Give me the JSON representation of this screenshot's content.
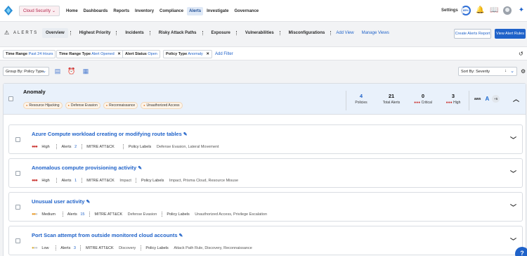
{
  "nav": {
    "tenant": "Cloud Security",
    "items": [
      "Home",
      "Dashboards",
      "Reports",
      "Inventory",
      "Compliance",
      "Alerts",
      "Investigate",
      "Governance"
    ],
    "active": "Alerts",
    "settings": "Settings",
    "score": "85%"
  },
  "subnav": {
    "title": "ALERTS",
    "tabs": [
      "Overview",
      "Highest Priority",
      "Incidents",
      "Risky Attack Paths",
      "Exposure",
      "Vulnerabilities",
      "Misconfigurations"
    ],
    "add_view": "Add View",
    "manage_views": "Manage Views",
    "report_button": "Create Alerts Report",
    "rules_button": "View Alert Rules"
  },
  "filters": [
    {
      "key": "Time Range",
      "value": "Past 24 Hours",
      "removable": false
    },
    {
      "key": "Time Range Type",
      "value": "Alert Opened",
      "removable": true
    },
    {
      "key": "Alert Status",
      "value": "Open",
      "removable": false
    },
    {
      "key": "Policy Type",
      "value": "Anomaly",
      "removable": true
    }
  ],
  "add_filter": "Add Filter",
  "toolbar": {
    "group_by": "Group By: Policy Type",
    "sort_by": "Sort By: Severity"
  },
  "group": {
    "title": "Anomaly",
    "tactics": [
      "Resource Hijacking",
      "Defense Evasion",
      "Reconnaissance",
      "Unauthorized Access"
    ],
    "stats": {
      "policies": {
        "value": "4",
        "label": "Policies"
      },
      "total_alerts": {
        "value": "21",
        "label": "Total Alerts"
      },
      "critical": {
        "value": "0",
        "label": "Critical"
      },
      "high": {
        "value": "3",
        "label": "High"
      }
    },
    "clouds": {
      "aws": "aws",
      "azure": "A",
      "more": "+5"
    }
  },
  "cards": [
    {
      "title": "Azure Compute workload creating or modifying route tables",
      "severity": "High",
      "severity_level": 3,
      "alerts_label": "Alerts",
      "alerts": "2",
      "framework": "MITRE ATT&CK",
      "framework_value": "",
      "labels_label": "Policy Labels",
      "labels": "Defense Evasion, Lateral Movement"
    },
    {
      "title": "Anomalous compute provisioning activity",
      "severity": "High",
      "severity_level": 3,
      "alerts_label": "Alerts",
      "alerts": "1",
      "framework": "MITRE ATT&CK",
      "framework_value": "Impact",
      "labels_label": "Policy Labels",
      "labels": "Impact, Prisma Cloud, Resource Misuse"
    },
    {
      "title": "Unusual user activity",
      "severity": "Medium",
      "severity_level": 2,
      "alerts_label": "Alerts",
      "alerts": "15",
      "framework": "MITRE ATT&CK",
      "framework_value": "Defense Evasion",
      "labels_label": "Policy Labels",
      "labels": "Unauthorized Access, Privilege Escalation"
    },
    {
      "title": "Port Scan attempt from outside monitored cloud accounts",
      "severity": "Low",
      "severity_level": 1,
      "alerts_label": "Alerts",
      "alerts": "3",
      "framework": "MITRE ATT&CK",
      "framework_value": "Discovery",
      "labels_label": "Policy Labels",
      "labels": "Attack Path Rule, Discovery, Reconnaissance"
    }
  ],
  "colors": {
    "accent": "#1f62c9",
    "group_header": "#e9f1fb",
    "tenant_text": "#b3264c"
  }
}
